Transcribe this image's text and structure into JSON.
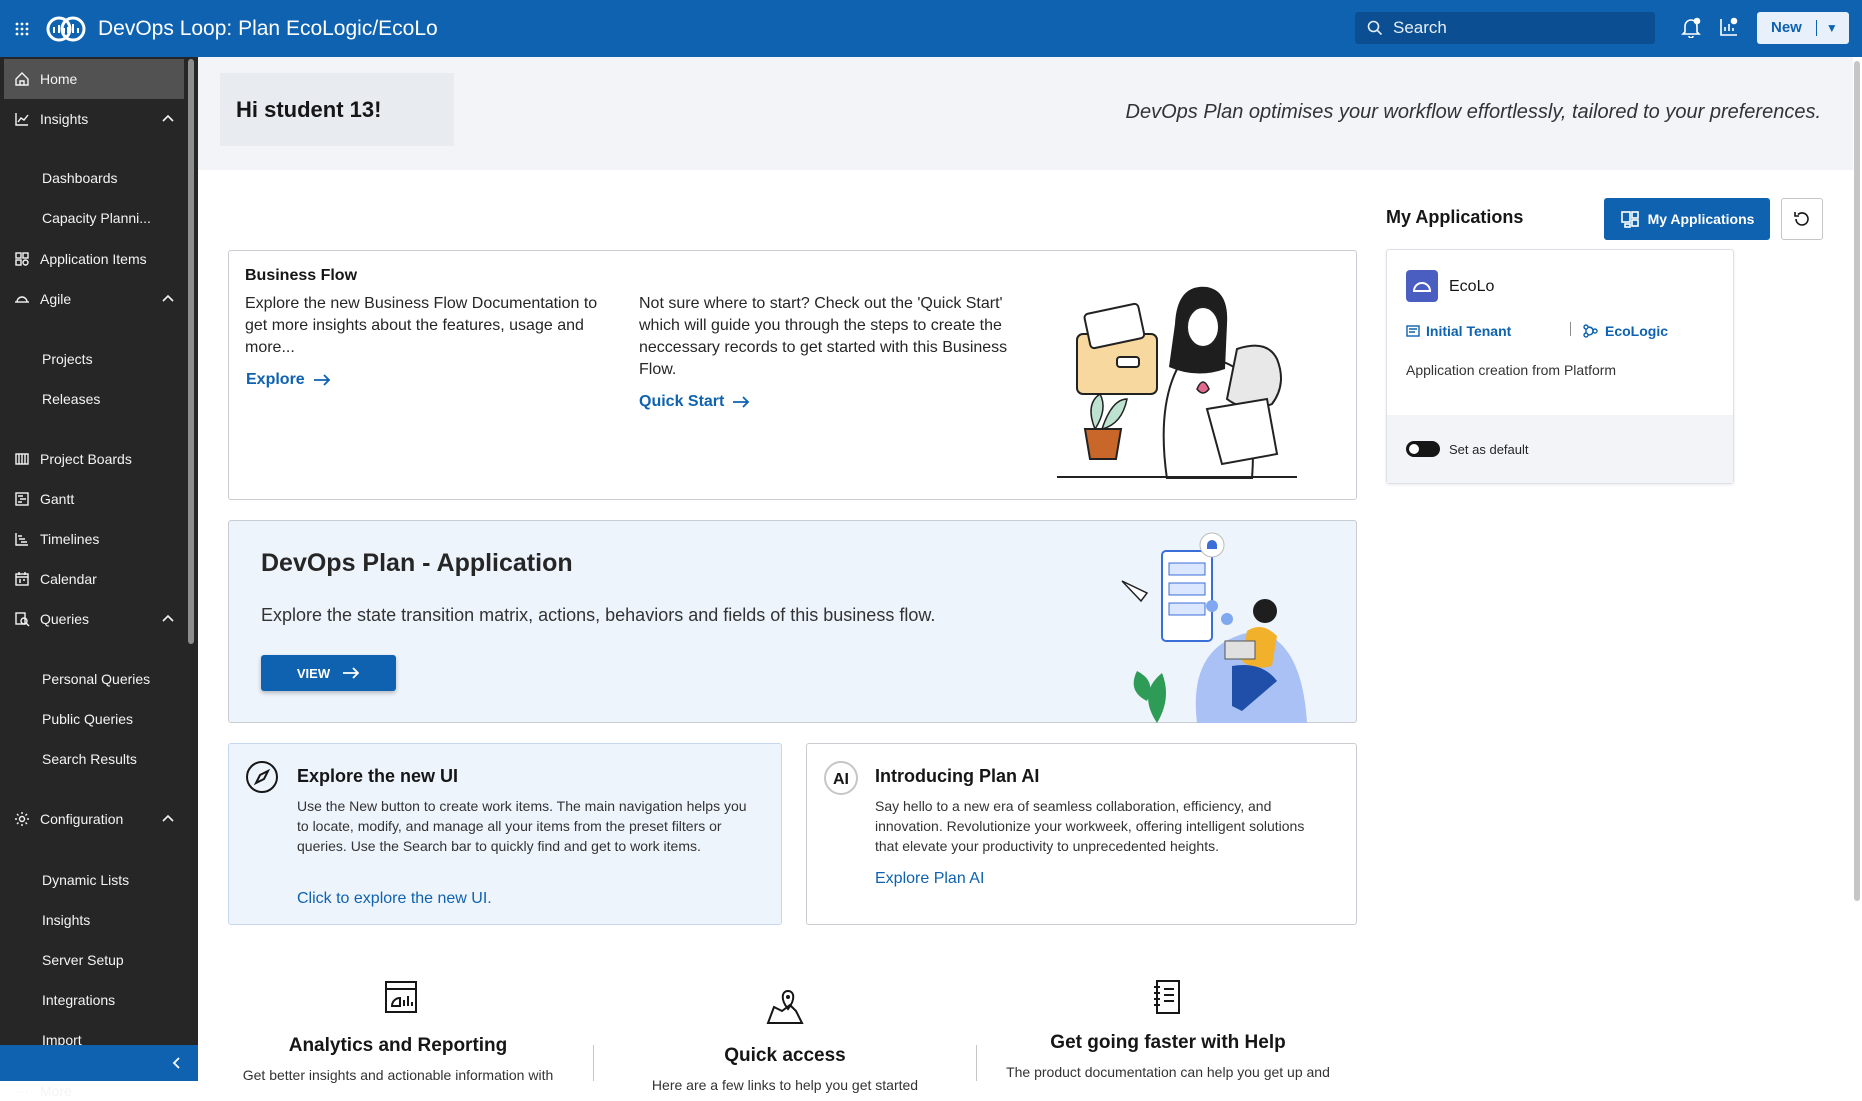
{
  "header": {
    "title": "DevOps Loop: Plan EcoLogic/EcoLo",
    "search_placeholder": "Search",
    "new_label": "New"
  },
  "sidebar": {
    "items": [
      {
        "label": "Home",
        "icon": "home-icon",
        "active": true
      },
      {
        "label": "Insights",
        "icon": "chart-line-icon",
        "expandable": true
      },
      {
        "label": "Dashboards",
        "sub": true
      },
      {
        "label": "Capacity Planni...",
        "sub": true
      },
      {
        "label": "Application Items",
        "icon": "app-items-icon"
      },
      {
        "label": "Agile",
        "icon": "agile-icon",
        "expandable": true
      },
      {
        "label": "Projects",
        "sub": true
      },
      {
        "label": "Releases",
        "sub": true
      },
      {
        "label": "Project Boards",
        "icon": "board-icon"
      },
      {
        "label": "Gantt",
        "icon": "gantt-icon"
      },
      {
        "label": "Timelines",
        "icon": "timeline-icon"
      },
      {
        "label": "Calendar",
        "icon": "calendar-icon"
      },
      {
        "label": "Queries",
        "icon": "query-icon",
        "expandable": true
      },
      {
        "label": "Personal Queries",
        "sub": true
      },
      {
        "label": "Public Queries",
        "sub": true
      },
      {
        "label": "Search Results",
        "sub": true
      },
      {
        "label": "Configuration",
        "icon": "gear-icon",
        "expandable": true
      },
      {
        "label": "Dynamic Lists",
        "sub": true
      },
      {
        "label": "Insights",
        "sub": true
      },
      {
        "label": "Server Setup",
        "sub": true
      },
      {
        "label": "Integrations",
        "sub": true
      },
      {
        "label": "Import",
        "sub": true
      },
      {
        "label": "More",
        "icon": "more-icon",
        "expandable": true
      }
    ]
  },
  "greeting": {
    "text": "Hi student 13!",
    "tagline": "DevOps Plan optimises your workflow effortlessly, tailored to your preferences."
  },
  "business_flow": {
    "title": "Business Flow",
    "left_text": "Explore the new Business Flow Documentation to get more insights about the features, usage and more...",
    "left_link": "Explore",
    "right_text": "Not sure where to start? Check out the 'Quick Start' which will guide you through the steps to create the neccessary records to get started with this Business Flow.",
    "right_link": "Quick Start"
  },
  "app_section": {
    "title": "DevOps Plan - Application",
    "description": "Explore the state transition matrix, actions, behaviors and fields of this business flow.",
    "button": "VIEW"
  },
  "explore_ui": {
    "title": "Explore the new UI",
    "body": "Use the New button to create work items. The main navigation helps you to locate, modify, and manage all your items from the preset filters or queries. Use the Search bar to quickly find and get to work items.",
    "link": "Click to explore the new UI."
  },
  "plan_ai": {
    "title": "Introducing Plan AI",
    "body": "Say hello to a new era of seamless collaboration, efficiency, and innovation. Revolutionize your workweek, offering intelligent solutions that elevate your productivity to unprecedented heights.",
    "link": "Explore Plan AI"
  },
  "my_applications": {
    "heading": "My Applications",
    "button": "My Applications",
    "app": {
      "name": "EcoLo",
      "tenant": "Initial Tenant",
      "project": "EcoLogic",
      "description": "Application creation from Platform",
      "default_label": "Set as default"
    }
  },
  "features": [
    {
      "title": "Analytics and Reporting",
      "desc": "Get better insights and actionable information with"
    },
    {
      "title": "Quick access",
      "desc": "Here are a few links to help you get started"
    },
    {
      "title": "Get going faster with Help",
      "desc": "The product documentation can help you get up and"
    }
  ],
  "colors": {
    "brand": "#0f62b0",
    "sidebar": "#262626"
  }
}
